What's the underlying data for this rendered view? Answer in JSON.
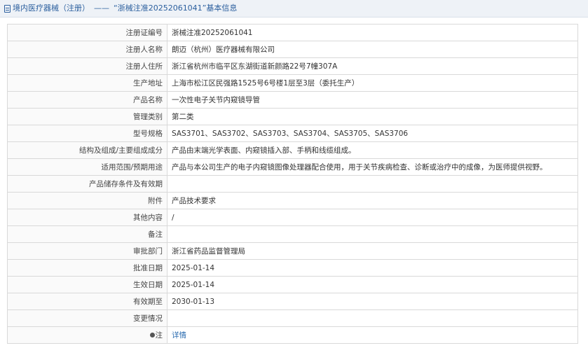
{
  "header": {
    "section": "境内医疗器械（注册）",
    "separator": "——",
    "title": "“浙械注准20252061041”基本信息"
  },
  "rows": [
    {
      "label": "注册证编号",
      "value": "浙械注准20252061041"
    },
    {
      "label": "注册人名称",
      "value": "朗迈（杭州）医疗器械有限公司"
    },
    {
      "label": "注册人住所",
      "value": "浙江省杭州市临平区东湖街道新颜路22号7幢307A"
    },
    {
      "label": "生产地址",
      "value": "上海市松江区民强路1525号6号楼1层至3层（委托生产）"
    },
    {
      "label": "产品名称",
      "value": "一次性电子关节内窥镜导管"
    },
    {
      "label": "管理类别",
      "value": "第二类"
    },
    {
      "label": "型号规格",
      "value": "SAS3701、SAS3702、SAS3703、SAS3704、SAS3705、SAS3706"
    },
    {
      "label": "结构及组成/主要组成成分",
      "value": "产品由末端光学表面、内窥镜插入部、手柄和线缆组成。"
    },
    {
      "label": "适用范围/预期用途",
      "value": "产品与本公司生产的电子内窥镜图像处理器配合使用，用于关节疾病检查、诊断或治疗中的成像，为医师提供视野。"
    },
    {
      "label": "产品储存条件及有效期",
      "value": ""
    },
    {
      "label": "附件",
      "value": "产品技术要求"
    },
    {
      "label": "其他内容",
      "value": "/"
    },
    {
      "label": "备注",
      "value": ""
    },
    {
      "label": "审批部门",
      "value": "浙江省药品监督管理局"
    },
    {
      "label": "批准日期",
      "value": "2025-01-14"
    },
    {
      "label": "生效日期",
      "value": "2025-01-14"
    },
    {
      "label": "有效期至",
      "value": "2030-01-13"
    },
    {
      "label": "变更情况",
      "value": ""
    }
  ],
  "note_row": {
    "label": "注",
    "icon": "info-dot-icon",
    "link": "详情"
  },
  "colors": {
    "title": "#2b5f9e",
    "link": "#2b6cb0",
    "border": "#d9d9d9"
  }
}
